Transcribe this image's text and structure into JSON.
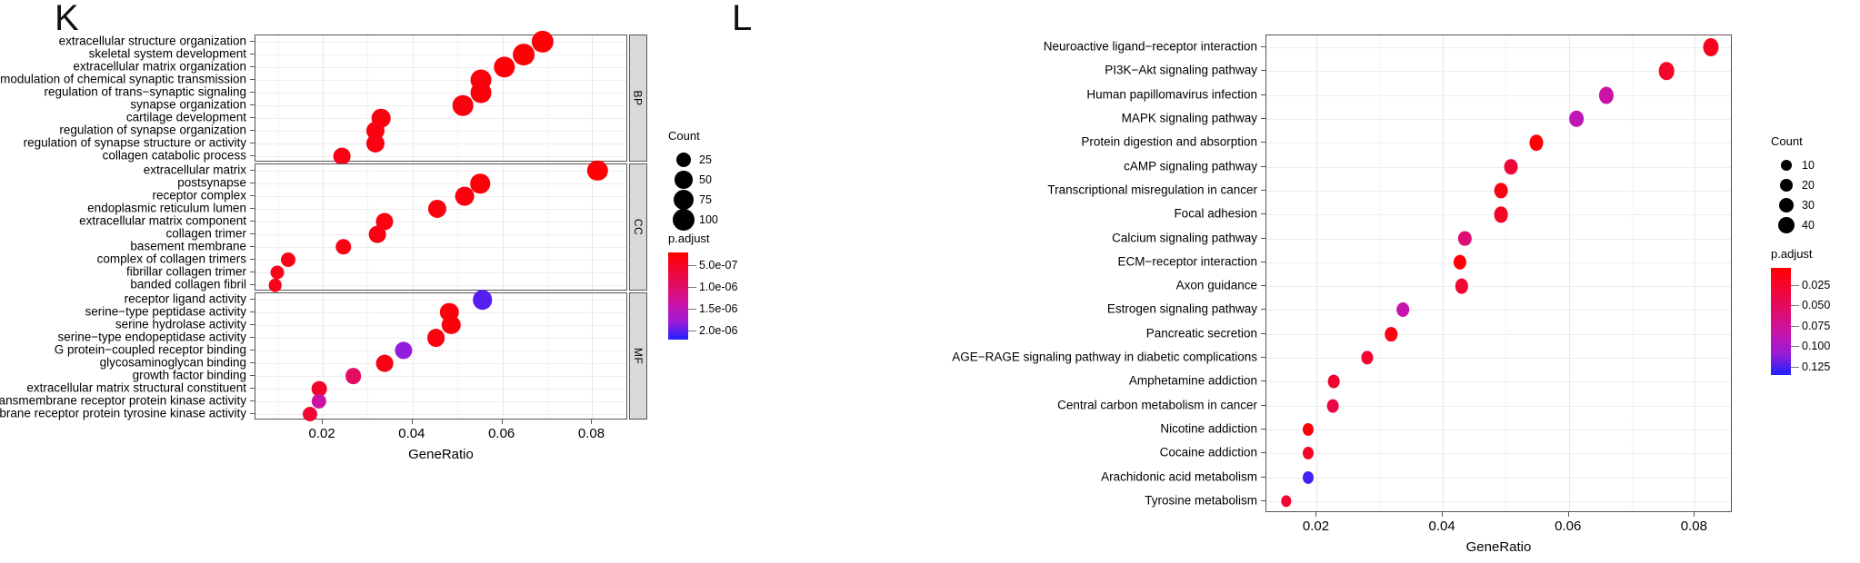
{
  "figure": {
    "panels": [
      {
        "letter": "K"
      },
      {
        "letter": "L"
      }
    ]
  },
  "chart_data": [
    {
      "type": "scatter",
      "name": "GO enrichment dot plot",
      "panel_letter": "K",
      "title": "",
      "xlabel": "GeneRatio",
      "ylabel": "",
      "xlim": [
        0.005,
        0.088
      ],
      "xticks": [
        0.02,
        0.04,
        0.06,
        0.08
      ],
      "xtick_labels": [
        "0.02",
        "0.04",
        "0.06",
        "0.08"
      ],
      "grid": true,
      "facets": [
        "BP",
        "CC",
        "MF"
      ],
      "size_legend": {
        "title": "Count",
        "values": [
          25,
          50,
          75,
          100
        ]
      },
      "color_legend": {
        "title": "p.adjust",
        "ticks": [
          5e-07,
          1e-06,
          1.5e-06,
          2e-06
        ],
        "tick_labels": [
          "5.0e-07",
          "1.0e-06",
          "1.5e-06",
          "2.0e-06"
        ],
        "low_color": "#ff0000",
        "high_color": "#2020ff",
        "range": [
          2e-07,
          2.2e-06
        ]
      },
      "points": [
        {
          "facet": "BP",
          "label": "extracellular structure organization",
          "x": 0.069,
          "count": 104,
          "padjust": 2.5e-07
        },
        {
          "facet": "BP",
          "label": "skeletal system development",
          "x": 0.0648,
          "count": 98,
          "padjust": 2.5e-07
        },
        {
          "facet": "BP",
          "label": "extracellular matrix organization",
          "x": 0.0604,
          "count": 92,
          "padjust": 2.5e-07
        },
        {
          "facet": "BP",
          "label": "modulation of chemical synaptic transmission",
          "x": 0.0552,
          "count": 86,
          "padjust": 2.8e-07
        },
        {
          "facet": "BP",
          "label": "regulation of trans−synaptic signaling",
          "x": 0.0552,
          "count": 86,
          "padjust": 2.8e-07
        },
        {
          "facet": "BP",
          "label": "synapse organization",
          "x": 0.0512,
          "count": 82,
          "padjust": 3e-07
        },
        {
          "facet": "BP",
          "label": "cartilage development",
          "x": 0.033,
          "count": 60,
          "padjust": 3.2e-07
        },
        {
          "facet": "BP",
          "label": "regulation of synapse organization",
          "x": 0.0318,
          "count": 55,
          "padjust": 3.4e-07
        },
        {
          "facet": "BP",
          "label": "regulation of synapse structure or activity",
          "x": 0.0318,
          "count": 55,
          "padjust": 3.4e-07
        },
        {
          "facet": "BP",
          "label": "collagen catabolic process",
          "x": 0.0242,
          "count": 42,
          "padjust": 3.6e-07
        },
        {
          "facet": "CC",
          "label": "extracellular matrix",
          "x": 0.0812,
          "count": 80,
          "padjust": 2.5e-07
        },
        {
          "facet": "CC",
          "label": "postsynapse",
          "x": 0.055,
          "count": 70,
          "padjust": 2.8e-07
        },
        {
          "facet": "CC",
          "label": "receptor complex",
          "x": 0.0516,
          "count": 62,
          "padjust": 3e-07
        },
        {
          "facet": "CC",
          "label": "endoplasmic reticulum lumen",
          "x": 0.0454,
          "count": 55,
          "padjust": 3.2e-07
        },
        {
          "facet": "CC",
          "label": "extracellular matrix component",
          "x": 0.0338,
          "count": 45,
          "padjust": 3.4e-07
        },
        {
          "facet": "CC",
          "label": "collagen trimer",
          "x": 0.0322,
          "count": 42,
          "padjust": 3.5e-07
        },
        {
          "facet": "CC",
          "label": "basement membrane",
          "x": 0.0246,
          "count": 32,
          "padjust": 3.6e-07
        },
        {
          "facet": "CC",
          "label": "complex of collagen trimers",
          "x": 0.0122,
          "count": 22,
          "padjust": 3.8e-07
        },
        {
          "facet": "CC",
          "label": "fibrillar collagen trimer",
          "x": 0.0098,
          "count": 16,
          "padjust": 4e-07
        },
        {
          "facet": "CC",
          "label": "banded collagen fibril",
          "x": 0.0094,
          "count": 14,
          "padjust": 4e-07
        },
        {
          "facet": "MF",
          "label": "receptor ligand activity",
          "x": 0.0556,
          "count": 70,
          "padjust": 2.05e-06
        },
        {
          "facet": "MF",
          "label": "serine−type peptidase activity",
          "x": 0.0482,
          "count": 58,
          "padjust": 3e-07
        },
        {
          "facet": "MF",
          "label": "serine hydrolase activity",
          "x": 0.0486,
          "count": 58,
          "padjust": 3e-07
        },
        {
          "facet": "MF",
          "label": "serine−type endopeptidase activity",
          "x": 0.0452,
          "count": 52,
          "padjust": 3.2e-07
        },
        {
          "facet": "MF",
          "label": "G protein−coupled receptor binding",
          "x": 0.038,
          "count": 46,
          "padjust": 1.85e-06
        },
        {
          "facet": "MF",
          "label": "glycosaminoglycan binding",
          "x": 0.0338,
          "count": 42,
          "padjust": 3.6e-07
        },
        {
          "facet": "MF",
          "label": "growth factor binding",
          "x": 0.0268,
          "count": 34,
          "padjust": 9.5e-07
        },
        {
          "facet": "MF",
          "label": "extracellular matrix structural constituent",
          "x": 0.0192,
          "count": 26,
          "padjust": 5e-07
        },
        {
          "facet": "MF",
          "label": "transmembrane receptor protein kinase activity",
          "x": 0.0192,
          "count": 24,
          "padjust": 1.35e-06
        },
        {
          "facet": "MF",
          "label": "transmembrane receptor protein tyrosine kinase activity",
          "x": 0.0172,
          "count": 22,
          "padjust": 6e-07
        }
      ]
    },
    {
      "type": "scatter",
      "name": "KEGG pathway dot plot",
      "panel_letter": "L",
      "title": "",
      "xlabel": "GeneRatio",
      "ylabel": "",
      "xlim": [
        0.012,
        0.086
      ],
      "xticks": [
        0.02,
        0.04,
        0.06,
        0.08
      ],
      "xtick_labels": [
        "0.02",
        "0.04",
        "0.06",
        "0.08"
      ],
      "grid": true,
      "size_legend": {
        "title": "Count",
        "values": [
          10,
          20,
          30,
          40
        ]
      },
      "color_legend": {
        "title": "p.adjust",
        "ticks": [
          0.025,
          0.05,
          0.075,
          0.1,
          0.125
        ],
        "tick_labels": [
          "0.025",
          "0.050",
          "0.075",
          "0.100",
          "0.125"
        ],
        "low_color": "#ff0000",
        "high_color": "#2020ff",
        "range": [
          0.004,
          0.135
        ]
      },
      "points": [
        {
          "label": "Neuroactive ligand−receptor interaction",
          "x": 0.0825,
          "count": 44,
          "padjust": 0.02
        },
        {
          "label": "PI3K−Akt signaling pathway",
          "x": 0.0755,
          "count": 40,
          "padjust": 0.025
        },
        {
          "label": "Human papillomavirus infection",
          "x": 0.066,
          "count": 36,
          "padjust": 0.082
        },
        {
          "label": "MAPK signaling pathway",
          "x": 0.0612,
          "count": 33,
          "padjust": 0.09
        },
        {
          "label": "Protein digestion and absorption",
          "x": 0.0548,
          "count": 28,
          "padjust": 0.006
        },
        {
          "label": "cAMP signaling pathway",
          "x": 0.0508,
          "count": 27,
          "padjust": 0.032
        },
        {
          "label": "Transcriptional misregulation in cancer",
          "x": 0.0492,
          "count": 26,
          "padjust": 0.012
        },
        {
          "label": "Focal adhesion",
          "x": 0.0492,
          "count": 26,
          "padjust": 0.022
        },
        {
          "label": "Calcium signaling pathway",
          "x": 0.0435,
          "count": 23,
          "padjust": 0.062
        },
        {
          "label": "ECM−receptor interaction",
          "x": 0.0427,
          "count": 22,
          "padjust": 0.005
        },
        {
          "label": "Axon guidance",
          "x": 0.043,
          "count": 23,
          "padjust": 0.03
        },
        {
          "label": "Estrogen signaling pathway",
          "x": 0.0337,
          "count": 19,
          "padjust": 0.085
        },
        {
          "label": "Pancreatic secretion",
          "x": 0.0318,
          "count": 18,
          "padjust": 0.012
        },
        {
          "label": "AGE−RAGE signaling pathway in diabetic complications",
          "x": 0.028,
          "count": 16,
          "padjust": 0.028
        },
        {
          "label": "Amphetamine addiction",
          "x": 0.0227,
          "count": 14,
          "padjust": 0.03
        },
        {
          "label": "Central carbon metabolism in cancer",
          "x": 0.0226,
          "count": 14,
          "padjust": 0.04
        },
        {
          "label": "Nicotine addiction",
          "x": 0.0187,
          "count": 11,
          "padjust": 0.008
        },
        {
          "label": "Cocaine addiction",
          "x": 0.0187,
          "count": 11,
          "padjust": 0.022
        },
        {
          "label": "Arachidonic acid metabolism",
          "x": 0.0187,
          "count": 11,
          "padjust": 0.128
        },
        {
          "label": "Tyrosine metabolism",
          "x": 0.0152,
          "count": 8,
          "padjust": 0.03
        }
      ]
    }
  ]
}
